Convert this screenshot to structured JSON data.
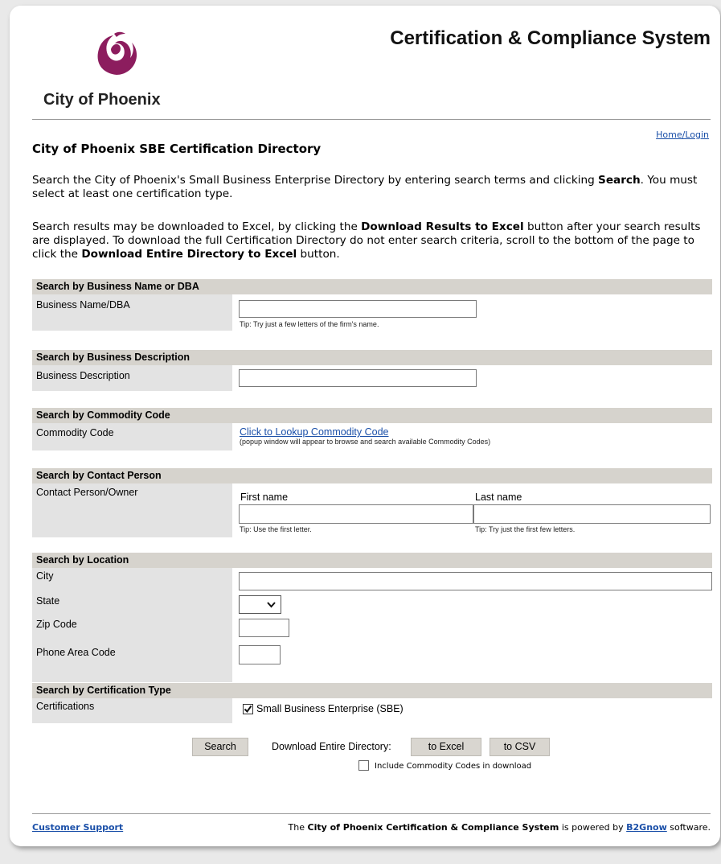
{
  "header": {
    "logo_text": "City of Phoenix",
    "system_title": "Certification & Compliance System",
    "home_link": "Home/Login"
  },
  "page": {
    "title": "City of Phoenix SBE Certification Directory",
    "intro1_a": "Search the City of Phoenix's Small Business Enterprise Directory by entering search terms and clicking ",
    "intro1_b": "Search",
    "intro1_c": ". You must select at least one certification type.",
    "intro2_a": "Search results may be downloaded to Excel, by clicking the ",
    "intro2_b": "Download Results to Excel",
    "intro2_c": " button after your search results are displayed. To download the full Certification Directory do not enter search criteria, scroll to the bottom of the page to click the ",
    "intro2_d": "Download Entire Directory to Excel",
    "intro2_e": " button."
  },
  "sections": {
    "name": {
      "heading": "Search by Business Name or DBA",
      "label": "Business Name/DBA",
      "value": "",
      "tip": "Tip: Try just a few letters of the firm's name."
    },
    "description": {
      "heading": "Search by Business Description",
      "label": "Business Description",
      "value": ""
    },
    "commodity": {
      "heading": "Search by Commodity Code",
      "label": "Commodity Code",
      "link": "Click to Lookup Commodity Code",
      "note": "(popup window will appear to browse and search available Commodity Codes)"
    },
    "contact": {
      "heading": "Search by Contact Person",
      "label": "Contact Person/Owner",
      "first_label": "First name",
      "last_label": "Last name",
      "first_value": "",
      "last_value": "",
      "first_tip": "Tip: Use the first letter.",
      "last_tip": "Tip: Try just the first few letters."
    },
    "location": {
      "heading": "Search by Location",
      "city_label": "City",
      "state_label": "State",
      "zip_label": "Zip Code",
      "phone_label": "Phone Area Code",
      "city_value": "",
      "state_value": "",
      "zip_value": "",
      "phone_value": ""
    },
    "certification": {
      "heading": "Search by Certification Type",
      "label": "Certifications",
      "option": "Small Business Enterprise (SBE)",
      "checked": true
    }
  },
  "actions": {
    "search": "Search",
    "download_label": "Download Entire Directory:",
    "to_excel": "to Excel",
    "to_csv": "to CSV",
    "include_codes": "Include Commodity Codes in download",
    "include_codes_checked": false
  },
  "footer": {
    "support": "Customer Support",
    "text_a": "The ",
    "text_b": "City of Phoenix Certification & Compliance System",
    "text_c": " is powered by ",
    "text_d": "B2Gnow",
    "text_e": " software."
  },
  "colors": {
    "brand": "#8c1d5e",
    "section_header": "#d6d3cd",
    "label_bg": "#e3e3e3",
    "link": "#1a4fa8"
  }
}
